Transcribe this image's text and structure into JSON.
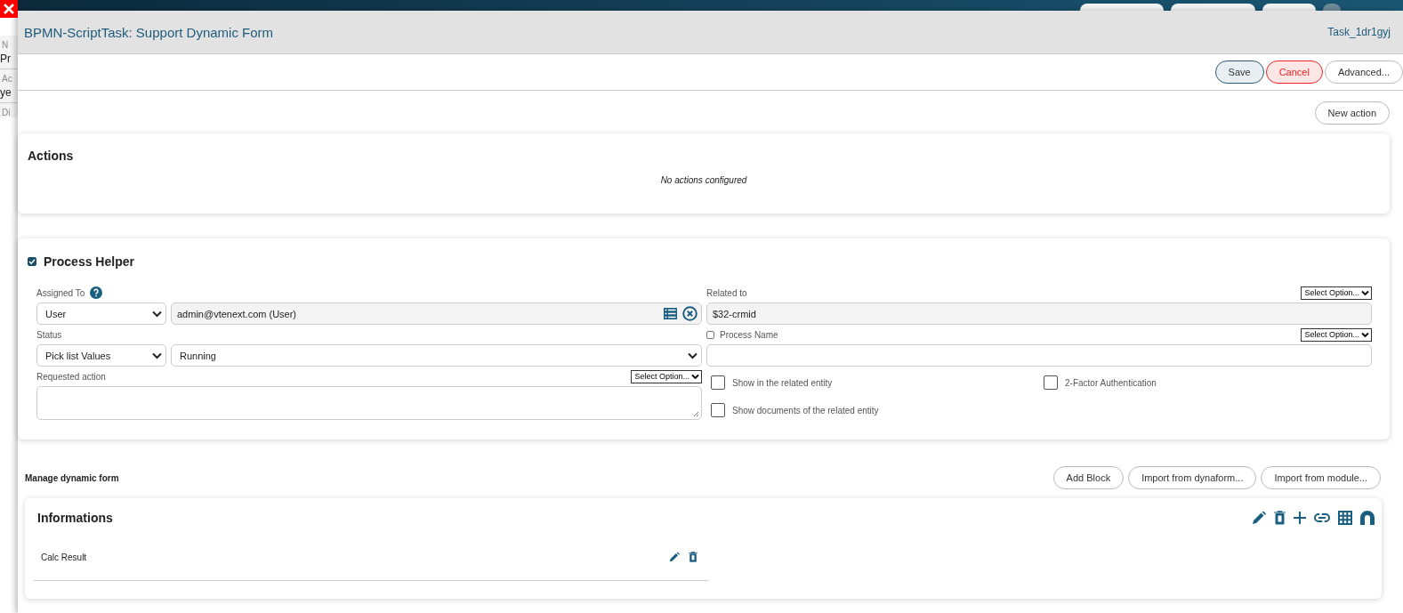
{
  "background_page": {
    "fragments": [
      "N",
      "Pr",
      "Ac",
      "ye",
      "Di"
    ]
  },
  "dialog": {
    "title": "BPMN-ScriptTask: Support Dynamic Form",
    "task_id": "Task_1dr1gyj",
    "buttons": [
      {
        "label": "Save",
        "kind": "primary"
      },
      {
        "label": "Cancel",
        "kind": "danger"
      },
      {
        "label": "Advanced...",
        "kind": "default"
      }
    ]
  },
  "actions": {
    "new_button": "New action",
    "title": "Actions",
    "empty_text": "No actions configured"
  },
  "process_helper": {
    "checked": true,
    "title": "Process Helper",
    "assigned_to": {
      "label": "Assigned To",
      "type": "User",
      "value": "admin@vtenext.com (User)"
    },
    "status": {
      "label": "Status",
      "type": "Pick list Values",
      "value": "Running"
    },
    "requested_action": {
      "label": "Requested action",
      "option": "Select Option..."
    },
    "related_to": {
      "label": "Related to",
      "option": "Select Option...",
      "value": "$32-crmid"
    },
    "process_name": {
      "label": "Process Name",
      "checked": false,
      "option": "Select Option..."
    },
    "checkboxes": [
      {
        "label": "Show in the related entity",
        "checked": false
      },
      {
        "label": "2-Factor Authentication",
        "checked": false
      },
      {
        "label": "Show documents of the related entity",
        "checked": false
      }
    ]
  },
  "dynamic_form": {
    "title": "Manage dynamic form",
    "buttons": [
      "Add Block",
      "Import from dynaform...",
      "Import from module..."
    ],
    "blocks": [
      {
        "title": "Informations",
        "fields": [
          {
            "label": "Calc Result"
          }
        ]
      }
    ]
  }
}
